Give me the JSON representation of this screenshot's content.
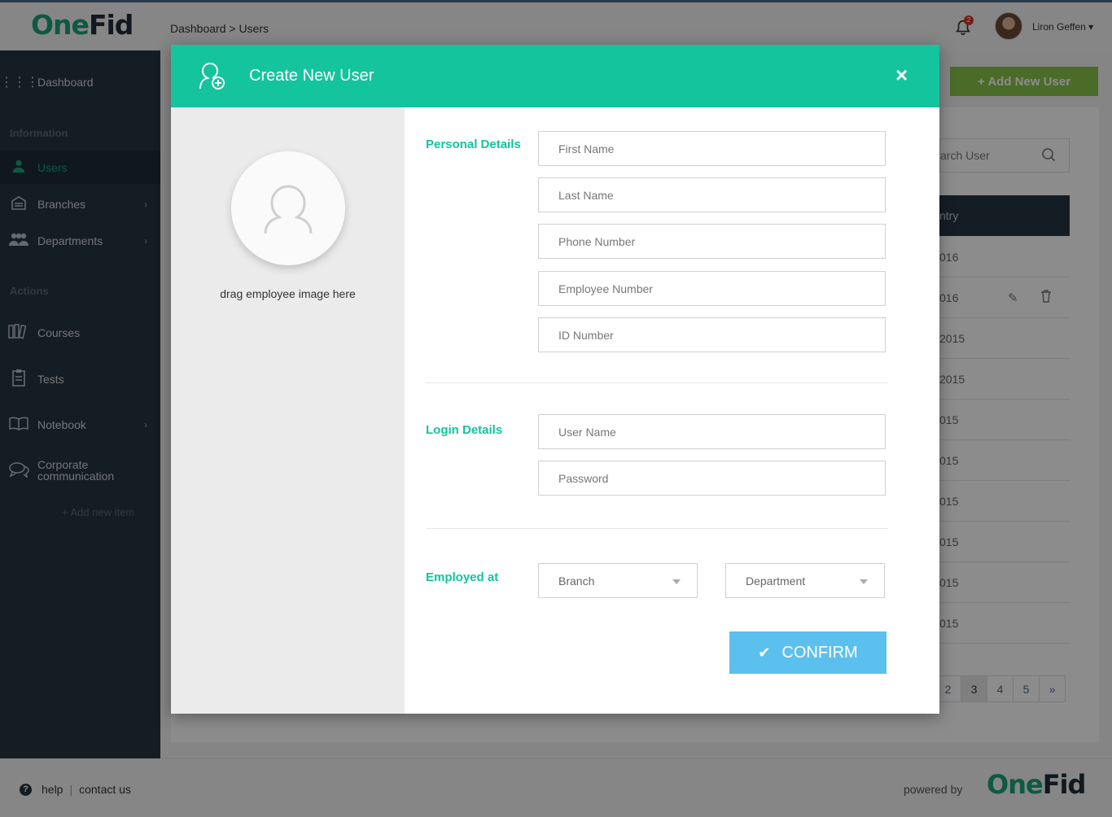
{
  "header": {
    "logo_one": "One",
    "logo_fid": "Fid",
    "breadcrumb": "Dashboard > Users",
    "notification_count": "2",
    "user_name": "Liron Geffen ▾"
  },
  "sidebar": {
    "dashboard": "Dashboard",
    "section_information": "Information",
    "users": "Users",
    "branches": "Branches",
    "departments": "Departments",
    "section_actions": "Actions",
    "courses": "Courses",
    "tests": "Tests",
    "notebook": "Notebook",
    "corporate_line1": "Corporate",
    "corporate_line2": "communication",
    "add_new_item": "+ Add new item"
  },
  "background": {
    "add_user_button": "+   Add New User",
    "search_placeholder": "arch User",
    "table_header": "ntry",
    "rows": [
      {
        "date": "016"
      },
      {
        "date": "016"
      },
      {
        "date": "2015"
      },
      {
        "date": "2015"
      },
      {
        "date": "015"
      },
      {
        "date": "015"
      },
      {
        "date": "015"
      },
      {
        "date": "015"
      },
      {
        "date": "015"
      },
      {
        "date": "015"
      }
    ],
    "pagination": [
      "2",
      "3",
      "4",
      "5",
      "»"
    ],
    "current_page": "3"
  },
  "modal": {
    "title": "Create New User",
    "close": "×",
    "drag_text": "drag employee image here",
    "personal_label": "Personal Details",
    "first_name_placeholder": "First Name",
    "last_name_placeholder": "Last Name",
    "phone_placeholder": "Phone Number",
    "employee_number_placeholder": "Employee Number",
    "id_number_placeholder": "ID Number",
    "login_label": "Login Details",
    "username_placeholder": "User Name",
    "password_placeholder": "Password",
    "employed_label": "Employed at",
    "branch_select": "Branch",
    "department_select": "Department",
    "confirm_label": "CONFIRM",
    "accent_color": "#13c49d",
    "confirm_color": "#5cc0ee"
  },
  "footer": {
    "help": "help",
    "separator": "|",
    "contact": "contact us",
    "powered_by": "powered by",
    "logo_one": "One",
    "logo_fid": "Fid"
  }
}
